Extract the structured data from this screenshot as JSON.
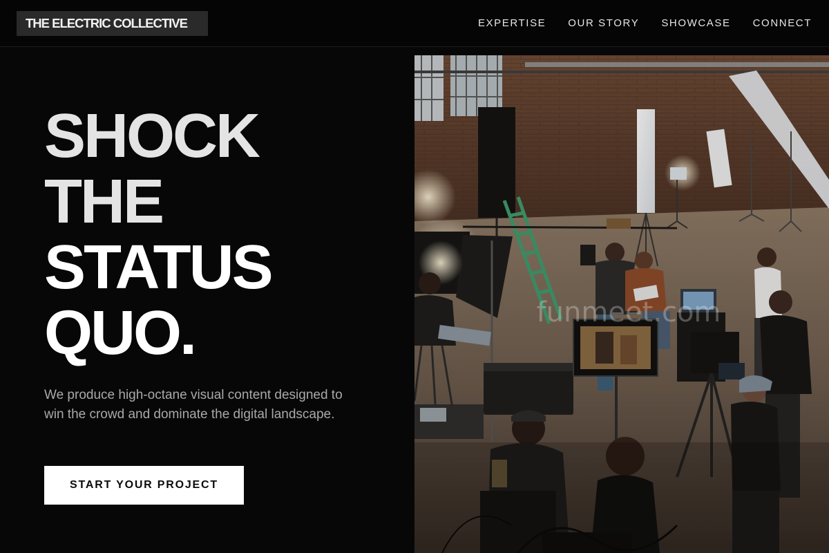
{
  "header": {
    "logo_text": "THE ELECTRIC COLLECTIVE",
    "nav": [
      {
        "label": "EXPERTISE"
      },
      {
        "label": "OUR STORY"
      },
      {
        "label": "SHOWCASE"
      },
      {
        "label": "CONNECT"
      }
    ]
  },
  "hero": {
    "title_lines": [
      "SHOCK",
      "THE",
      "STATUS",
      "QUO."
    ],
    "subtitle": "We produce high-octane visual content designed to win the crowd and dominate the digital landscape.",
    "cta_label": "START YOUR PROJECT",
    "image": {
      "subject": "film-crew-in-warehouse-photo",
      "watermark": "funmeet.com"
    }
  },
  "colors": {
    "background": "#070707",
    "header_background": "#050505",
    "logo_background": "#2a2a2a",
    "title_text": "#ffffff",
    "subtitle_text": "#a9a9a9",
    "cta_background": "#ffffff",
    "cta_text": "#0a0a0a"
  }
}
